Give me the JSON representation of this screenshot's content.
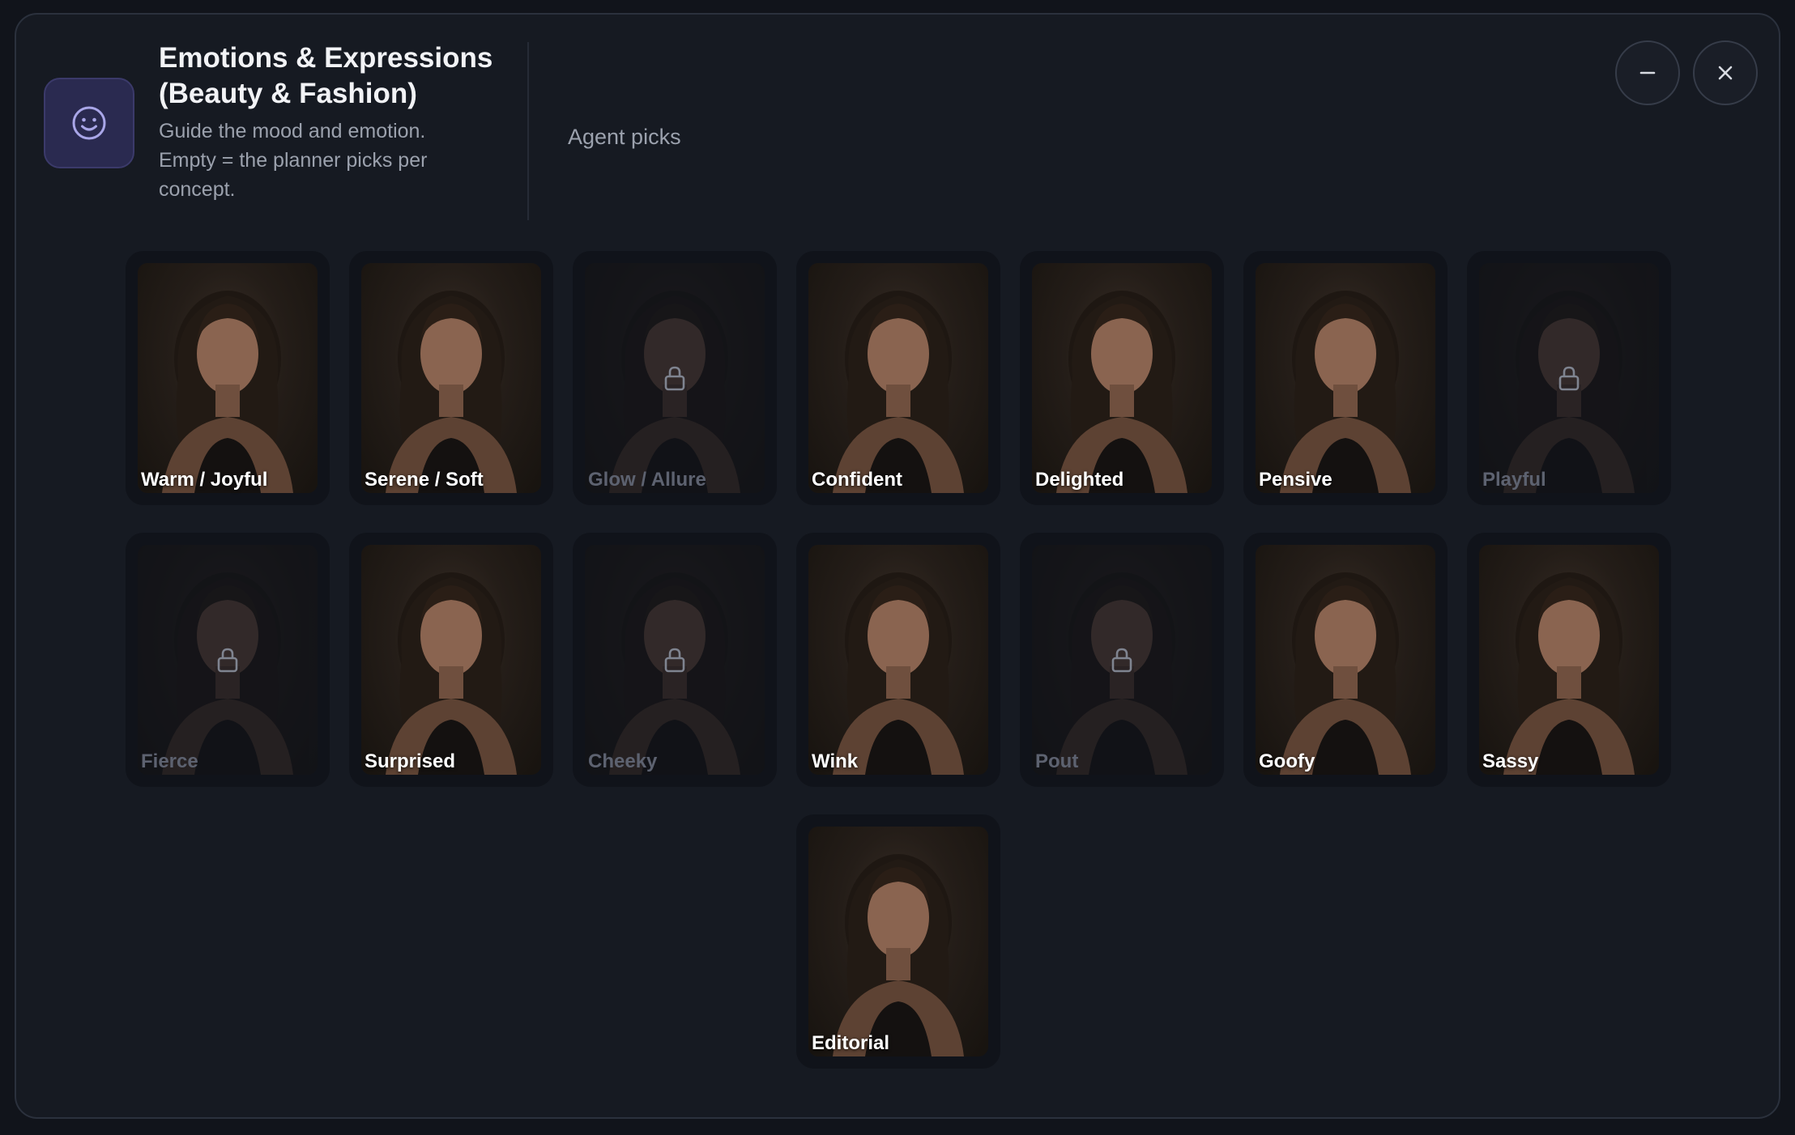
{
  "header": {
    "title": "Emotions & Expressions\n(Beauty & Fashion)",
    "subtitle": "Guide the mood and emotion.\nEmpty = the planner picks per\nconcept.",
    "status": "Agent picks",
    "icon": "smiley-face-icon",
    "minimize_icon": "minus-icon",
    "close_icon": "close-icon"
  },
  "colors": {
    "accent_icon_bg": "#2a2a50",
    "accent_icon_stroke": "#a9a6e8",
    "panel_bg": "#161a22",
    "card_bg": "#10131a"
  },
  "options": [
    {
      "label": "Warm / Joyful",
      "locked": false
    },
    {
      "label": "Serene / Soft",
      "locked": false
    },
    {
      "label": "Glow / Allure",
      "locked": true
    },
    {
      "label": "Confident",
      "locked": false
    },
    {
      "label": "Delighted",
      "locked": false
    },
    {
      "label": "Pensive",
      "locked": false
    },
    {
      "label": "Playful",
      "locked": true
    },
    {
      "label": "Fierce",
      "locked": true
    },
    {
      "label": "Surprised",
      "locked": false
    },
    {
      "label": "Cheeky",
      "locked": true
    },
    {
      "label": "Wink",
      "locked": false
    },
    {
      "label": "Pout",
      "locked": true
    },
    {
      "label": "Goofy",
      "locked": false
    },
    {
      "label": "Sassy",
      "locked": false
    },
    {
      "label": "Editorial",
      "locked": false
    }
  ]
}
